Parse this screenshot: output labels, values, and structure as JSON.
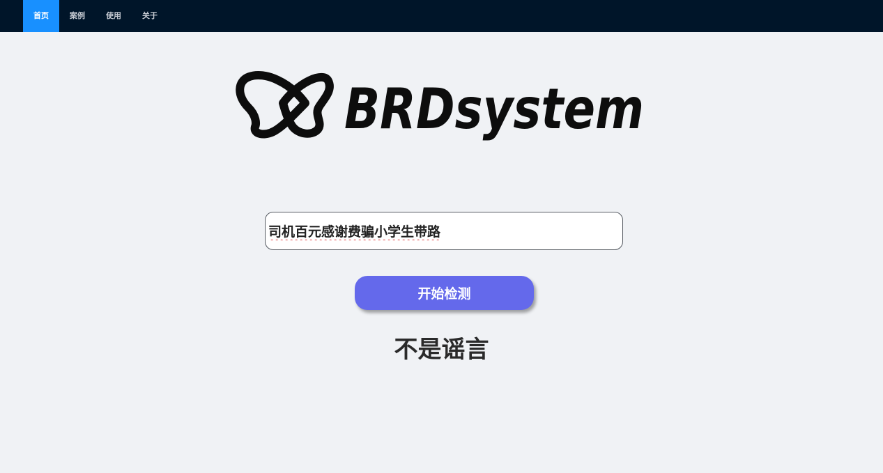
{
  "nav": {
    "items": [
      {
        "label": "首页",
        "active": true
      },
      {
        "label": "案例",
        "active": false
      },
      {
        "label": "使用",
        "active": false
      },
      {
        "label": "关于",
        "active": false
      }
    ]
  },
  "logo": {
    "icon": "butterfly-logo-icon",
    "text": "BRDsystem"
  },
  "search": {
    "value": "司机百元感谢费骗小学生带路"
  },
  "detect_button": {
    "label": "开始检测"
  },
  "result": {
    "text": "不是谣言"
  },
  "colors": {
    "nav_background": "#001529",
    "nav_active": "#1890ff",
    "page_background": "#f0f2f5",
    "button": "#6469eb"
  }
}
